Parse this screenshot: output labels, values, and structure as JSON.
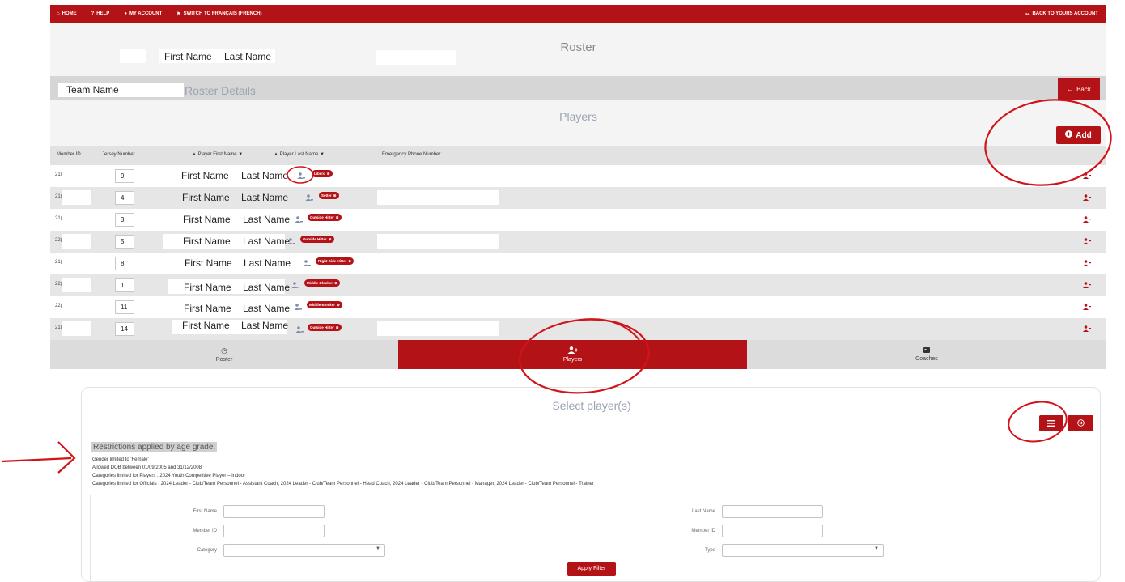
{
  "nav": {
    "home": "HOME",
    "help": "HELP",
    "my_account": "MY ACCOUNT",
    "switch_lang": "SWITCH TO FRANÇAIS (FRENCH)",
    "back_account": "BACK TO YOURS ACCOUNT"
  },
  "roster": {
    "title": "Roster",
    "first_name": "First Name",
    "last_name": "Last Name"
  },
  "details": {
    "team_name": "Team Name",
    "title": "Roster Details",
    "back_label": "Back"
  },
  "players": {
    "title": "Players",
    "add_label": "Add"
  },
  "table": {
    "headers": {
      "member_id": "Member ID",
      "jersey": "Jersey Number",
      "first": "▲ Player First Name ▼",
      "last": "▲ Player Last Name ▼",
      "phone": "Emergency Phone Number"
    },
    "rows": [
      {
        "id": "21(",
        "jersey": "9",
        "first": "First Name",
        "last": "Last Name",
        "position": "Libero"
      },
      {
        "id": "21(",
        "jersey": "4",
        "first": "First Name",
        "last": "Last Name",
        "position": "Setter"
      },
      {
        "id": "21(",
        "jersey": "3",
        "first": "First Name",
        "last": "Last Name",
        "position": "Outside Hitter"
      },
      {
        "id": "22(",
        "jersey": "5",
        "first": "First Name",
        "last": "Last Name",
        "position": "Outside Hitter"
      },
      {
        "id": "21(",
        "jersey": "8",
        "first": "First Name",
        "last": "Last Name",
        "position": "Right Side Hitter"
      },
      {
        "id": "22(",
        "jersey": "1",
        "first": "First Name",
        "last": "Last Name",
        "position": "Middle Blocker"
      },
      {
        "id": "22(",
        "jersey": "11",
        "first": "First Name",
        "last": "Last Name",
        "position": "Middle Blocker"
      },
      {
        "id": "21(",
        "jersey": "14",
        "first": "First Name",
        "last": "Last Name",
        "position": "Outside Hitter"
      }
    ]
  },
  "tabs": {
    "roster": "Roster",
    "players": "Players",
    "coaches": "Coaches"
  },
  "select": {
    "title": "Select player(s)",
    "restrictions_head": "Restrictions applied by age grade:",
    "lines": [
      "Gender limited to 'Female'",
      "Allowed DOB between 01/09/2005 and 31/12/2008",
      "Categories limited for Players : 2024 Youth Competitive Player – Indoor",
      "Categories limited for Officials : 2024 Leader - Club/Team Personnel - Assistant Coach, 2024 Leader - Club/Team Personnel - Head Coach, 2024 Leader - Club/Team Personnel - Manager, 2024 Leader - Club/Team Personnel - Trainer"
    ]
  },
  "filter": {
    "first_name": "First Name",
    "last_name": "Last Name",
    "member_id": "Member ID",
    "member_id_2": "Member ID",
    "category": "Category",
    "type": "Type",
    "apply": "Apply Filter"
  },
  "colors": {
    "brand_red": "#b31217",
    "annotation_red": "#d2141a"
  }
}
